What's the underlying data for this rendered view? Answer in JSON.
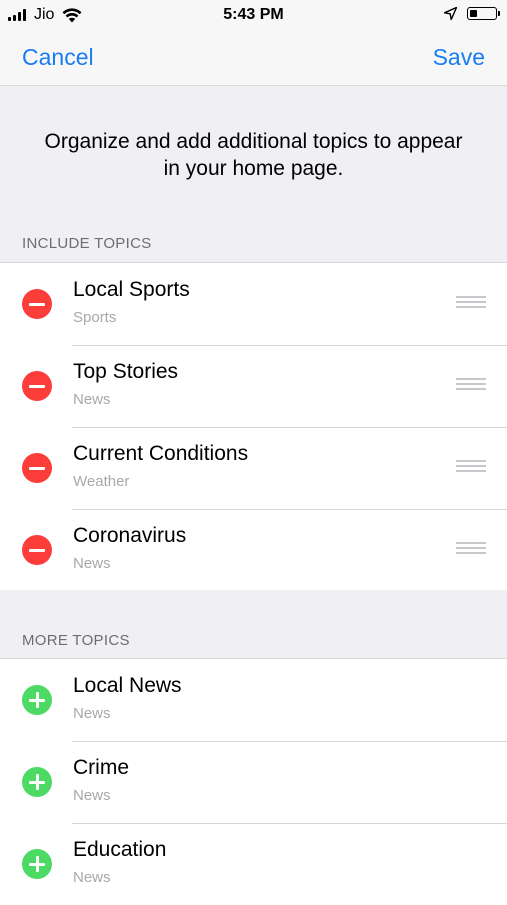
{
  "status_bar": {
    "carrier": "Jio",
    "time": "5:43 PM"
  },
  "nav": {
    "cancel_label": "Cancel",
    "save_label": "Save"
  },
  "intro_text": "Organize and add additional topics to appear in your home page.",
  "include_section": {
    "header": "INCLUDE TOPICS",
    "items": [
      {
        "title": "Local Sports",
        "subtitle": "Sports"
      },
      {
        "title": "Top Stories",
        "subtitle": "News"
      },
      {
        "title": "Current Conditions",
        "subtitle": "Weather"
      },
      {
        "title": "Coronavirus",
        "subtitle": "News"
      }
    ]
  },
  "more_section": {
    "header": "MORE TOPICS",
    "items": [
      {
        "title": "Local News",
        "subtitle": "News"
      },
      {
        "title": "Crime",
        "subtitle": "News"
      },
      {
        "title": "Education",
        "subtitle": "News"
      }
    ]
  },
  "colors": {
    "accent": "#1a7cf5",
    "remove": "#fc3d39",
    "add": "#4cd964"
  }
}
